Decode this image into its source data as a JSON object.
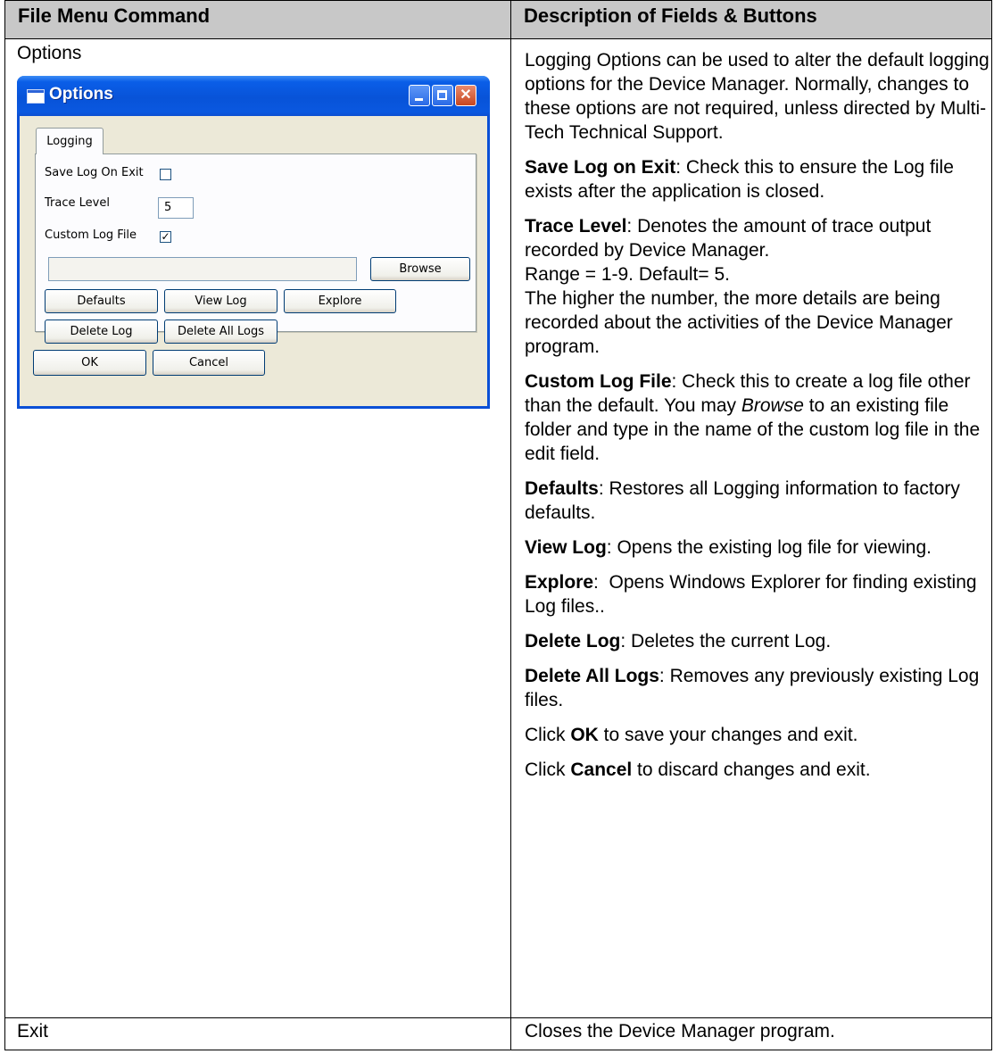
{
  "table": {
    "headers": [
      "File Menu Command",
      "Description of Fields & Buttons"
    ],
    "options_label": "Options",
    "exit_label": "Exit",
    "exit_description": "Closes the Device Manager program."
  },
  "dialog": {
    "title": "Options",
    "tab": "Logging",
    "save_log_on_exit_label": "Save Log On Exit",
    "save_log_on_exit_checked": false,
    "trace_level_label": "Trace Level",
    "trace_level_value": "5",
    "custom_log_file_label": "Custom Log File",
    "custom_log_file_checked": true,
    "custom_log_file_path": "",
    "browse_label": "Browse",
    "defaults_label": "Defaults",
    "view_log_label": "View Log",
    "explore_label": "Explore",
    "delete_log_label": "Delete Log",
    "delete_all_logs_label": "Delete All Logs",
    "ok_label": "OK",
    "cancel_label": "Cancel",
    "checkmark": "✓"
  },
  "descriptions": {
    "intro": "Logging Options can be used to alter the default logging options for the Device Manager. Normally, changes to these options are not required, unless directed by Multi-Tech Technical Support.",
    "save_log_term": "Save Log on Exit",
    "save_log_text": ": Check this to ensure the Log file exists after the application is closed.",
    "trace_term": "Trace Level",
    "trace_text_1": ": Denotes the amount of trace output recorded by Device Manager.",
    "trace_text_2": "Range = 1-9. Default= 5.",
    "trace_text_3": "The higher the number, the more details are being recorded about the activities of the Device Manager program.",
    "custom_term": "Custom Log File",
    "custom_text_1": ": Check this to create a log file other than the default. You may ",
    "custom_browse": "Browse",
    "custom_text_2": " to an existing file folder and type in the name of the custom log file in the edit field.",
    "defaults_term": "Defaults",
    "defaults_text": ": Restores all Logging information to factory defaults.",
    "view_term": "View Log",
    "view_text": ": Opens the existing log file for viewing.",
    "explore_term": "Explore",
    "explore_text": ":  Opens Windows Explorer for finding existing Log files..",
    "delete_term": "Delete Log",
    "delete_text": ": Deletes the current Log.",
    "delete_all_term": "Delete All Logs",
    "delete_all_text": ": Removes any previously existing Log files.",
    "ok_pre": "Click ",
    "ok_term": "OK",
    "ok_text": " to save your changes and exit.",
    "cancel_pre": "Click ",
    "cancel_term": "Cancel",
    "cancel_text": " to discard changes and exit."
  }
}
